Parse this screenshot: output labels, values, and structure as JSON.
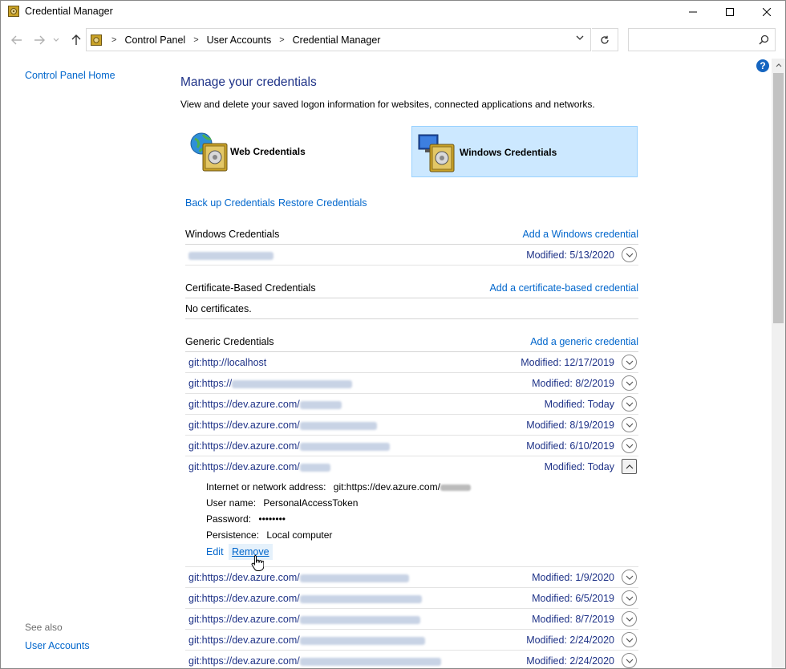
{
  "window": {
    "title": "Credential Manager"
  },
  "breadcrumb": [
    "Control Panel",
    "User Accounts",
    "Credential Manager"
  ],
  "leftnav": {
    "home": "Control Panel Home",
    "see_also": "See also",
    "user_accounts": "User Accounts"
  },
  "main": {
    "title": "Manage your credentials",
    "description": "View and delete your saved logon information for websites, connected applications and networks.",
    "tiles": {
      "web": "Web Credentials",
      "windows": "Windows Credentials"
    },
    "backup": "Back up Credentials",
    "restore": "Restore Credentials"
  },
  "windows_section": {
    "title": "Windows Credentials",
    "add": "Add a Windows credential",
    "rows": [
      {
        "name": "",
        "modified": "Modified:  5/13/2020"
      }
    ]
  },
  "cert_section": {
    "title": "Certificate-Based Credentials",
    "add": "Add a certificate-based credential",
    "empty": "No certificates."
  },
  "generic_section": {
    "title": "Generic Credentials",
    "add": "Add a generic credential",
    "rows": [
      {
        "name": "git:http://localhost",
        "modified": "Modified:  12/17/2019"
      },
      {
        "name": "git:https://",
        "modified": "Modified:  8/2/2019"
      },
      {
        "name": "git:https://dev.azure.com/",
        "modified": "Modified:  Today"
      },
      {
        "name": "git:https://dev.azure.com/",
        "modified": "Modified:  8/19/2019"
      },
      {
        "name": "git:https://dev.azure.com/",
        "modified": "Modified:  6/10/2019"
      },
      {
        "name": "git:https://dev.azure.com/",
        "modified": "Modified:  Today"
      },
      {
        "name": "git:https://dev.azure.com/",
        "modified": "Modified:  1/9/2020"
      },
      {
        "name": "git:https://dev.azure.com/",
        "modified": "Modified:  6/5/2019"
      },
      {
        "name": "git:https://dev.azure.com/",
        "modified": "Modified:  8/7/2019"
      },
      {
        "name": "git:https://dev.azure.com/",
        "modified": "Modified:  2/24/2020"
      },
      {
        "name": "git:https://dev.azure.com/",
        "modified": "Modified:  2/24/2020"
      }
    ],
    "details": {
      "address_label": "Internet or network address:",
      "address_value": "git:https://dev.azure.com/",
      "user_label": "User name:",
      "user_value": "PersonalAccessToken",
      "password_label": "Password:",
      "password_value": "••••••••",
      "persistence_label": "Persistence:",
      "persistence_value": "Local computer",
      "edit": "Edit",
      "remove": "Remove"
    }
  },
  "help": "?"
}
